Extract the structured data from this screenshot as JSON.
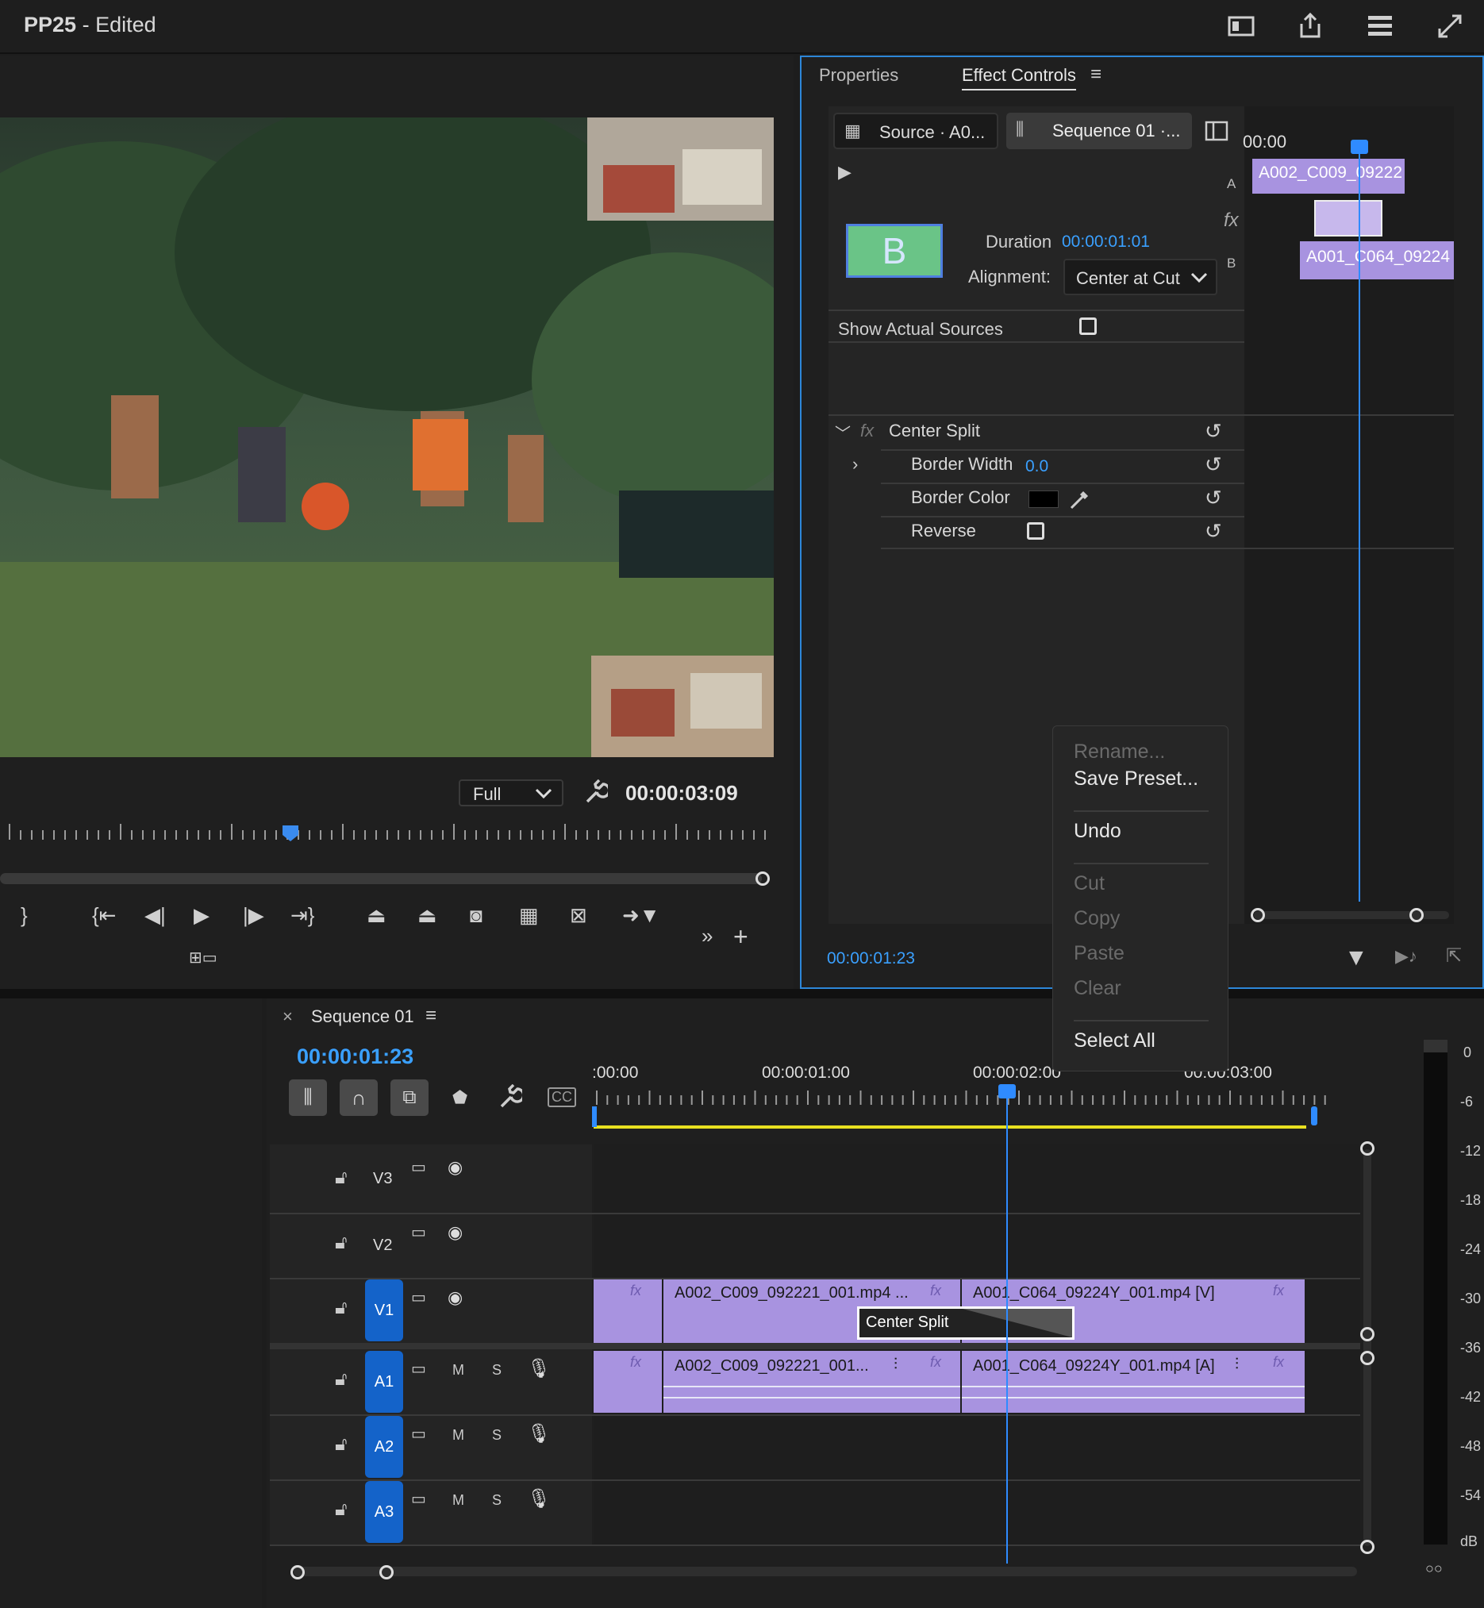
{
  "app": {
    "title": "PP25",
    "status": "- Edited"
  },
  "program": {
    "fit": "Full",
    "timecode": "00:00:03:09"
  },
  "effect_controls": {
    "tab_properties": "Properties",
    "tab_effect_controls": "Effect Controls",
    "source_label": "Source · A0...",
    "sequence_label": "Sequence 01 ·...",
    "duration_label": "Duration",
    "duration_value": "00:00:01:01",
    "alignment_label": "Alignment:",
    "alignment_value": "Center at Cut",
    "show_sources": "Show Actual Sources",
    "effect_name": "Center Split",
    "border_width_label": "Border Width",
    "border_width_value": "0.0",
    "border_color_label": "Border Color",
    "reverse_label": "Reverse",
    "timecode": "00:00:01:23",
    "mini_time": "00:00",
    "mini_clip_a": "A002_C009_09222",
    "mini_clip_b": "A001_C064_09224",
    "track_a": "A",
    "track_b": "B",
    "thumb_letter": "B"
  },
  "context_menu": {
    "rename": "Rename...",
    "save_preset": "Save Preset...",
    "undo": "Undo",
    "cut": "Cut",
    "copy": "Copy",
    "paste": "Paste",
    "clear": "Clear",
    "select_all": "Select All"
  },
  "timeline": {
    "sequence_name": "Sequence 01",
    "timecode": "00:00:01:23",
    "ruler": [
      ":00:00",
      "00:00:01:00",
      "00:00:02:00",
      "00:00:03:00"
    ],
    "tracks": [
      "V3",
      "V2",
      "V1",
      "A1",
      "A2",
      "A3"
    ],
    "mute": "M",
    "solo": "S",
    "clip_v1_a": "A002_C009_092221_001.mp4 ...",
    "clip_v1_b": "A001_C064_09224Y_001.mp4 [V]",
    "clip_a1_a": "A002_C009_092221_001...",
    "clip_a1_b": "A001_C064_09224Y_001.mp4 [A]",
    "transition": "Center Split",
    "fx": "fx"
  },
  "meter": {
    "scale": [
      "0",
      "-6",
      "-12",
      "-18",
      "-24",
      "-30",
      "-36",
      "-42",
      "-48",
      "-54",
      "dB"
    ]
  }
}
